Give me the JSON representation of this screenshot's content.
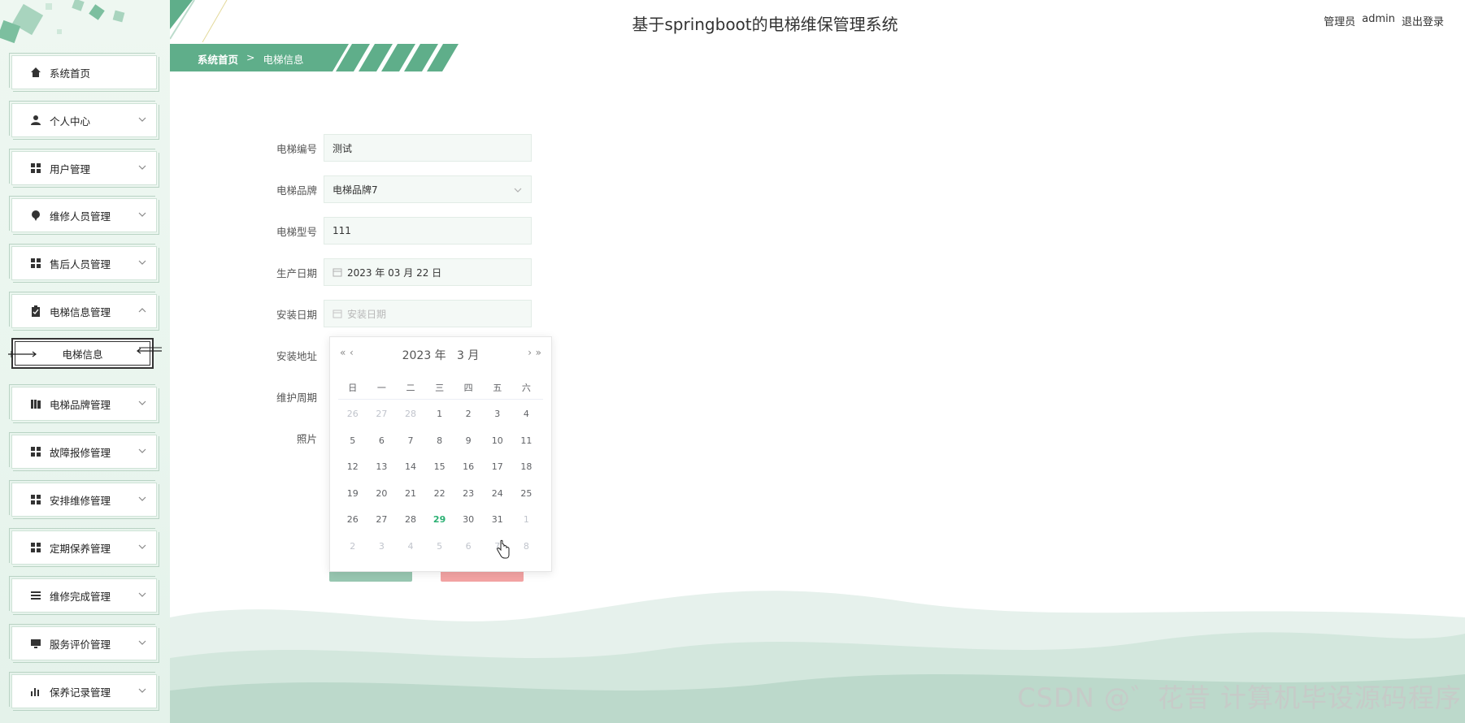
{
  "header": {
    "title": "基于springboot的电梯维保管理系统",
    "role": "管理员",
    "username": "admin",
    "logout": "退出登录"
  },
  "breadcrumb": {
    "home": "系统首页",
    "separator": ">",
    "current": "电梯信息"
  },
  "sidebar": {
    "items": [
      {
        "label": "系统首页",
        "icon": "home-icon",
        "expandable": false
      },
      {
        "label": "个人中心",
        "icon": "user-icon",
        "expandable": true
      },
      {
        "label": "用户管理",
        "icon": "grid-icon",
        "expandable": true
      },
      {
        "label": "维修人员管理",
        "icon": "pin-icon",
        "expandable": true
      },
      {
        "label": "售后人员管理",
        "icon": "grid-icon",
        "expandable": true
      },
      {
        "label": "电梯信息管理",
        "icon": "clipboard-icon",
        "expandable": true,
        "expanded": true
      },
      {
        "label": "电梯品牌管理",
        "icon": "book-icon",
        "expandable": true
      },
      {
        "label": "故障报修管理",
        "icon": "grid-icon",
        "expandable": true
      },
      {
        "label": "安排维修管理",
        "icon": "grid-icon",
        "expandable": true
      },
      {
        "label": "定期保养管理",
        "icon": "grid-icon",
        "expandable": true
      },
      {
        "label": "维修完成管理",
        "icon": "list-icon",
        "expandable": true
      },
      {
        "label": "服务评价管理",
        "icon": "monitor-icon",
        "expandable": true
      },
      {
        "label": "保养记录管理",
        "icon": "bar-chart-icon",
        "expandable": true
      }
    ],
    "active_sub": "电梯信息"
  },
  "form": {
    "elevator_no": {
      "label": "电梯编号",
      "value": "测试"
    },
    "brand": {
      "label": "电梯品牌",
      "value": "电梯品牌7"
    },
    "model": {
      "label": "电梯型号",
      "value": "111"
    },
    "production_date": {
      "label": "生产日期",
      "value": "2023 年 03 月 22 日"
    },
    "install_date": {
      "label": "安装日期",
      "placeholder": "安装日期"
    },
    "install_address": {
      "label": "安装地址"
    },
    "maintenance_cycle": {
      "label": "维护周期"
    },
    "photo": {
      "label": "照片"
    }
  },
  "calendar": {
    "year_label": "2023 年",
    "month_label": "3 月",
    "prev_year": "«",
    "prev_month": "‹",
    "next_month": "›",
    "next_year": "»",
    "weekdays": [
      "日",
      "一",
      "二",
      "三",
      "四",
      "五",
      "六"
    ],
    "weeks": [
      [
        {
          "d": "26",
          "m": 1
        },
        {
          "d": "27",
          "m": 1
        },
        {
          "d": "28",
          "m": 1
        },
        {
          "d": "1"
        },
        {
          "d": "2"
        },
        {
          "d": "3"
        },
        {
          "d": "4"
        }
      ],
      [
        {
          "d": "5"
        },
        {
          "d": "6"
        },
        {
          "d": "7"
        },
        {
          "d": "8"
        },
        {
          "d": "9"
        },
        {
          "d": "10"
        },
        {
          "d": "11"
        }
      ],
      [
        {
          "d": "12"
        },
        {
          "d": "13"
        },
        {
          "d": "14"
        },
        {
          "d": "15"
        },
        {
          "d": "16"
        },
        {
          "d": "17"
        },
        {
          "d": "18"
        }
      ],
      [
        {
          "d": "19"
        },
        {
          "d": "20"
        },
        {
          "d": "21"
        },
        {
          "d": "22"
        },
        {
          "d": "23"
        },
        {
          "d": "24"
        },
        {
          "d": "25"
        }
      ],
      [
        {
          "d": "26"
        },
        {
          "d": "27"
        },
        {
          "d": "28"
        },
        {
          "d": "29",
          "t": 1
        },
        {
          "d": "30"
        },
        {
          "d": "31"
        },
        {
          "d": "1",
          "m": 1
        }
      ],
      [
        {
          "d": "2",
          "m": 1
        },
        {
          "d": "3",
          "m": 1
        },
        {
          "d": "4",
          "m": 1
        },
        {
          "d": "5",
          "m": 1
        },
        {
          "d": "6",
          "m": 1
        },
        {
          "d": "7",
          "m": 1
        },
        {
          "d": "8",
          "m": 1
        }
      ]
    ]
  },
  "watermark": "CSDN @゛花昔  计算机毕设源码程序",
  "colors": {
    "accent": "#5fae8a",
    "today": "#2bb073",
    "save": "#98c7b1",
    "cancel": "#f3a3a3"
  }
}
